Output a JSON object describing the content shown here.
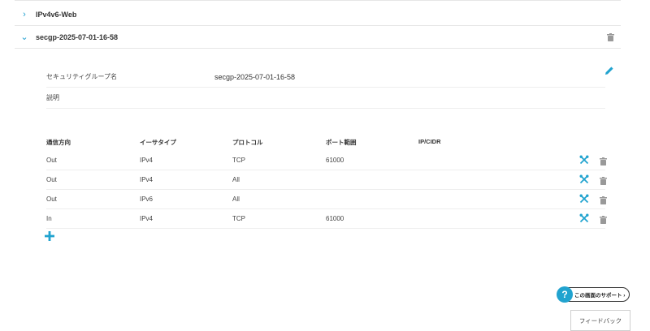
{
  "groups": [
    {
      "name": "IPv4v6-Web",
      "expanded": false,
      "chevron": "›"
    },
    {
      "name": "secgp-2025-07-01-16-58",
      "expanded": true,
      "chevron": "⌄"
    }
  ],
  "detail": {
    "name_label": "セキュリティグループ名",
    "name_value": "secgp-2025-07-01-16-58",
    "desc_label": "説明",
    "desc_value": ""
  },
  "rules_table": {
    "headers": [
      "通信方向",
      "イーサタイプ",
      "プロトコル",
      "ポート範囲",
      "IP/CIDR"
    ],
    "rows": [
      {
        "direction": "Out",
        "ethertype": "IPv4",
        "protocol": "TCP",
        "port": "61000",
        "cidr": ""
      },
      {
        "direction": "Out",
        "ethertype": "IPv4",
        "protocol": "All",
        "port": "",
        "cidr": ""
      },
      {
        "direction": "Out",
        "ethertype": "IPv6",
        "protocol": "All",
        "port": "",
        "cidr": ""
      },
      {
        "direction": "In",
        "ethertype": "IPv4",
        "protocol": "TCP",
        "port": "61000",
        "cidr": ""
      }
    ]
  },
  "support": {
    "icon": "?",
    "label": "この画面のサポート ›"
  },
  "feedback": {
    "label": "フィードバック"
  },
  "colors": {
    "accent": "#21a3cf",
    "icon_gray": "#999999",
    "border": "#e6e6e6"
  }
}
